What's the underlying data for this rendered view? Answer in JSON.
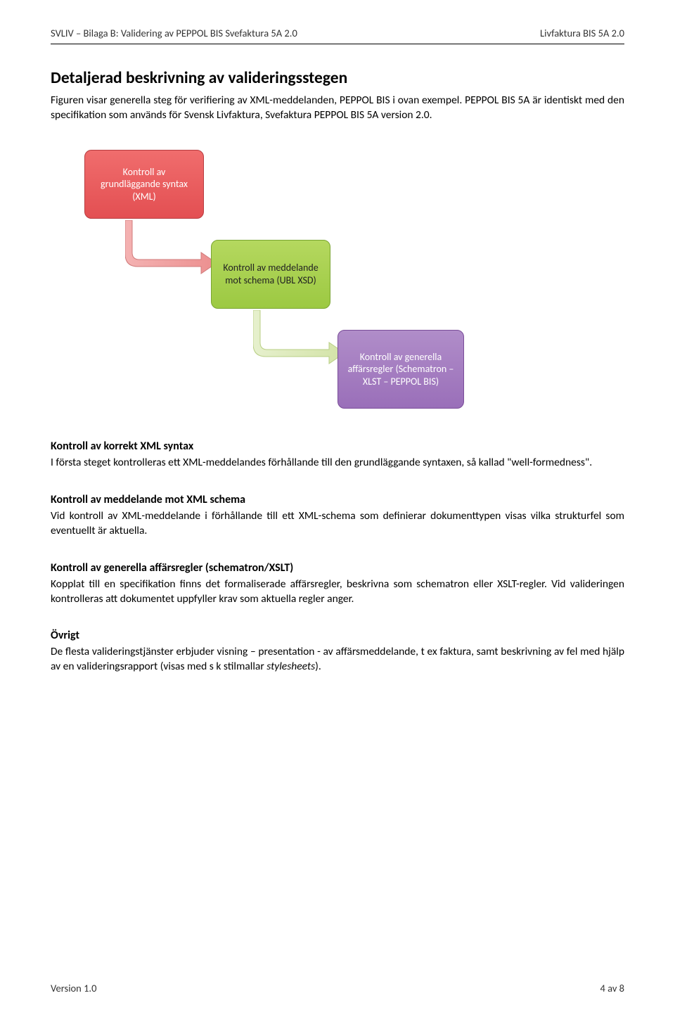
{
  "header": {
    "left": "SVLIV – Bilaga B: Validering av PEPPOL BIS Svefaktura 5A 2.0",
    "right": "Livfaktura BIS 5A 2.0"
  },
  "section_title": "Detaljerad beskrivning av valideringsstegen",
  "intro_p1": "Figuren visar generella steg för verifiering av XML-meddelanden, PEPPOL BIS i ovan exempel. PEPPOL BIS 5A är identiskt med den specifikation som används för Svensk Livfaktura, Svefaktura PEPPOL BIS 5A version 2.0.",
  "diagram": {
    "box1": "Kontroll av grundläggande syntax (XML)",
    "box2": "Kontroll av meddelande mot schema (UBL XSD)",
    "box3": "Kontroll av generella affärsregler (Schematron – XLST – PEPPOL BIS)"
  },
  "sections": {
    "s1_h": "Kontroll av korrekt XML syntax",
    "s1_p": "I första steget kontrolleras ett XML-meddelandes förhållande till den grundläggande syntaxen, så kallad \"well-formedness\".",
    "s2_h": "Kontroll av meddelande mot XML schema",
    "s2_p": "Vid kontroll av XML-meddelande i förhållande till ett XML-schema som definierar dokumenttypen visas vilka strukturfel som eventuellt är aktuella.",
    "s3_h": "Kontroll av generella affärsregler (schematron/XSLT)",
    "s3_p": "Kopplat till en specifikation finns det formaliserade affärsregler, beskrivna som schematron eller XSLT-regler. Vid valideringen kontrolleras att dokumentet uppfyller krav som aktuella regler anger.",
    "s4_h": "Övrigt",
    "s4_p_a": "De flesta valideringstjänster erbjuder visning – presentation - av affärsmeddelande, t ex faktura, samt beskrivning av fel med hjälp av en valideringsrapport (visas med s k stilmallar ",
    "s4_p_italic": "stylesheets",
    "s4_p_b": ")."
  },
  "footer": {
    "left": "Version 1.0",
    "right": "4 av 8"
  }
}
